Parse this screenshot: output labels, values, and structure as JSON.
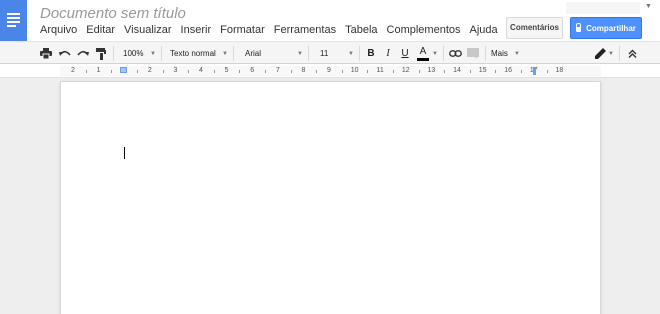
{
  "app": {
    "title": "Documento sem título",
    "logo_icon": "docs-icon"
  },
  "menu": [
    "Arquivo",
    "Editar",
    "Visualizar",
    "Inserir",
    "Formatar",
    "Ferramentas",
    "Tabela",
    "Complementos",
    "Ajuda"
  ],
  "header": {
    "comments_label": "Comentários",
    "share_label": "Compartilhar",
    "share_icon": "lock-icon",
    "account_icon": "dropdown-arrow-icon"
  },
  "toolbar": {
    "zoom": "100%",
    "style": "Texto normal",
    "font": "Arial",
    "size": "11",
    "bold_glyph": "B",
    "italic_glyph": "I",
    "underline_glyph": "U",
    "text_color_glyph": "A",
    "more_label": "Mais",
    "icons": [
      "print-icon",
      "undo-icon",
      "redo-icon",
      "paint-format-icon",
      "link-icon",
      "comment-icon",
      "pencil-icon",
      "collapse-icon"
    ]
  },
  "ruler": {
    "labels": [
      "2",
      "1",
      "1",
      "2",
      "3",
      "4",
      "5",
      "6",
      "7",
      "8",
      "9",
      "10",
      "11",
      "12",
      "13",
      "14",
      "15",
      "16",
      "17",
      "18"
    ]
  },
  "colors": {
    "accent": "#4a86e8",
    "share_button": "#4d90fe",
    "text_color_bar": "#000000"
  }
}
